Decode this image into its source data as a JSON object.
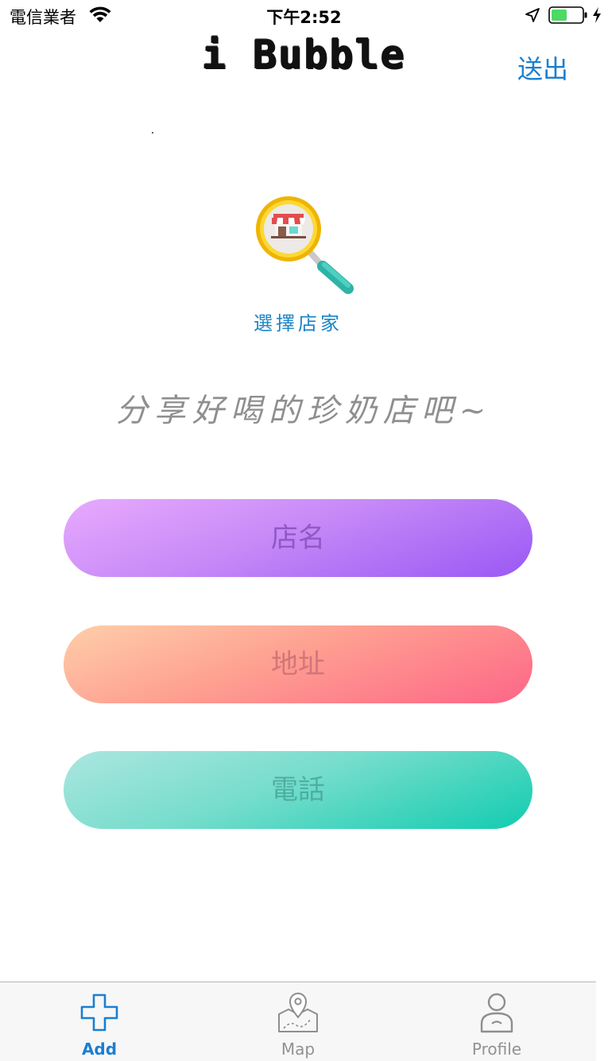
{
  "status_bar": {
    "carrier": "電信業者",
    "time": "下午2:52"
  },
  "nav": {
    "title": "i Bubble",
    "send_label": "送出"
  },
  "store_picker": {
    "label": "選擇店家"
  },
  "slogan": "分享好喝的珍奶店吧~",
  "form": {
    "store_name_placeholder": "店名",
    "address_placeholder": "地址",
    "phone_placeholder": "電話"
  },
  "tabs": [
    {
      "label": "Add",
      "icon": "plus-icon",
      "active": true
    },
    {
      "label": "Map",
      "icon": "map-pin-icon",
      "active": false
    },
    {
      "label": "Profile",
      "icon": "person-icon",
      "active": false
    }
  ],
  "colors": {
    "accent": "#1a7fd1",
    "name_pill": "#b072f6",
    "address_pill": "#fd8b8c",
    "phone_pill": "#4cd6bf",
    "battery": "#4cd964"
  }
}
